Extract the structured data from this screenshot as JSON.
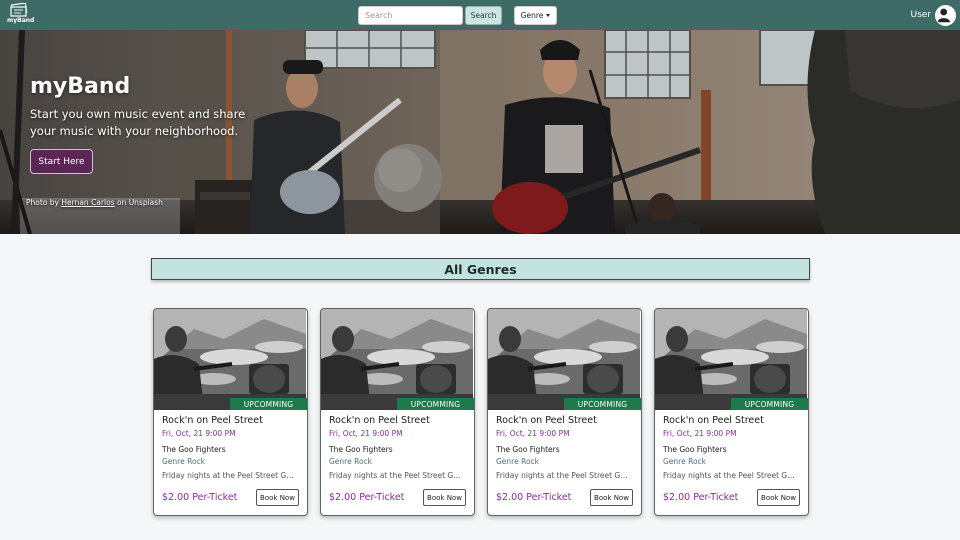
{
  "brand": {
    "name": "myBand",
    "icon": "ticket-stack-icon"
  },
  "nav": {
    "search_placeholder": "Search",
    "search_button": "Search",
    "genre_label": "Genre",
    "user_label": "User",
    "user_icon": "user-circle-icon"
  },
  "hero": {
    "title": "myBand",
    "subtitle": "Start you own music event and share your music with your neighborhood.",
    "cta": "Start Here",
    "credit_prefix": "Photo by ",
    "credit_author": "Hernan Carlos",
    "credit_suffix": " on Unsplash"
  },
  "section": {
    "heading": "All Genres"
  },
  "events": [
    {
      "status": "UPCOMMING",
      "title": "Rock'n on Peel Street",
      "datetime": "Fri, Oct, 21 9:00 PM",
      "band": "The Goo Fighters",
      "genre": "Genre Rock",
      "description": "Friday nights at the Peel Street Garage",
      "price": "$2.00 Per-Ticket",
      "button": "Book Now"
    },
    {
      "status": "UPCOMMING",
      "title": "Rock'n on Peel Street",
      "datetime": "Fri, Oct, 21 9:00 PM",
      "band": "The Goo Fighters",
      "genre": "Genre Rock",
      "description": "Friday nights at the Peel Street Garage",
      "price": "$2.00 Per-Ticket",
      "button": "Book Now"
    },
    {
      "status": "UPCOMMING",
      "title": "Rock'n on Peel Street",
      "datetime": "Fri, Oct, 21 9:00 PM",
      "band": "The Goo Fighters",
      "genre": "Genre Rock",
      "description": "Friday nights at the Peel Street Garage",
      "price": "$2.00 Per-Ticket",
      "button": "Book Now"
    },
    {
      "status": "UPCOMMING",
      "title": "Rock'n on Peel Street",
      "datetime": "Fri, Oct, 21 9:00 PM",
      "band": "The Goo Fighters",
      "genre": "Genre Rock",
      "description": "Friday nights at the Peel Street Garage",
      "price": "$2.00 Per-Ticket",
      "button": "Book Now"
    }
  ],
  "colors": {
    "navbar": "#3f6b66",
    "accent_purple": "#8a2aa0",
    "cta_background": "#5b2556",
    "heading_background": "#c3e3e0",
    "status_green": "#1e7a4b"
  }
}
